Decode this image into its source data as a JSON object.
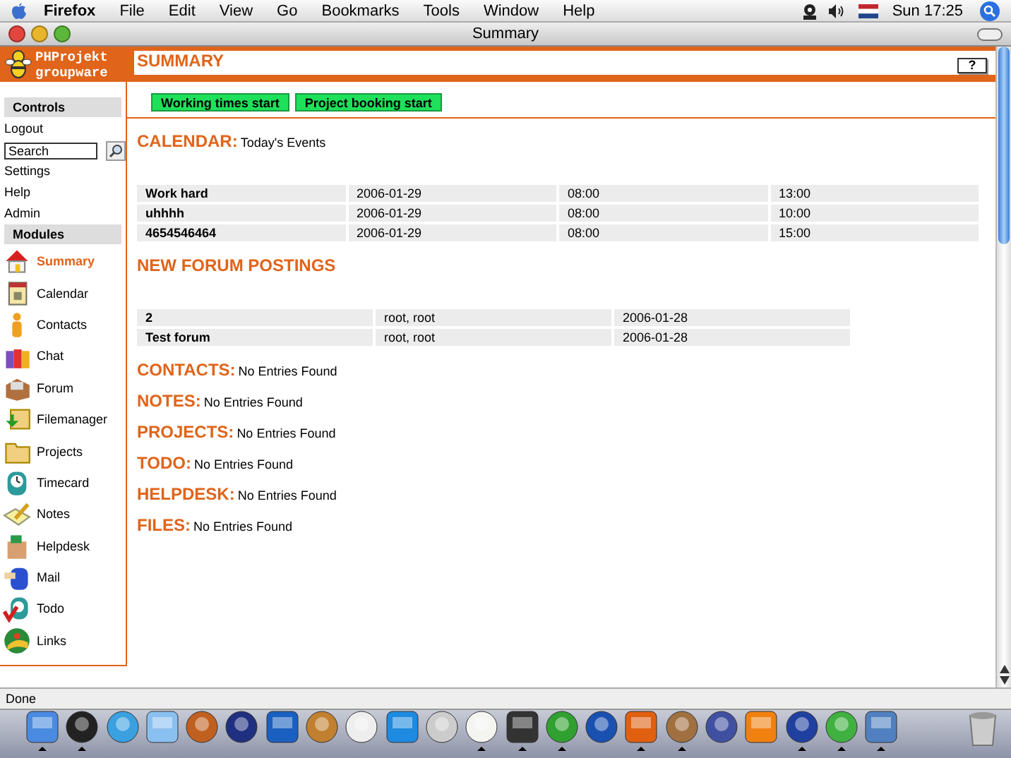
{
  "menubar": {
    "app": "Firefox",
    "items": [
      "File",
      "Edit",
      "View",
      "Go",
      "Bookmarks",
      "Tools",
      "Window",
      "Help"
    ],
    "clock": "Sun 17:25"
  },
  "window": {
    "title": "Summary"
  },
  "logo": {
    "line1": "PHProjekt",
    "line2": "groupware"
  },
  "page_title": "SUMMARY",
  "help_button": "?",
  "action_buttons": [
    "Working times start",
    "Project booking start"
  ],
  "sidebar": {
    "controls_heading": "Controls",
    "controls": [
      {
        "kind": "link",
        "label": "Logout"
      },
      {
        "kind": "search",
        "placeholder": "Search"
      },
      {
        "kind": "link",
        "label": "Settings"
      },
      {
        "kind": "link",
        "label": "Help"
      },
      {
        "kind": "link",
        "label": "Admin"
      }
    ],
    "modules_heading": "Modules",
    "modules": [
      {
        "label": "Summary",
        "selected": true
      },
      {
        "label": "Calendar",
        "selected": false
      },
      {
        "label": "Contacts",
        "selected": false
      },
      {
        "label": "Chat",
        "selected": false
      },
      {
        "label": "Forum",
        "selected": false
      },
      {
        "label": "Filemanager",
        "selected": false
      },
      {
        "label": "Projects",
        "selected": false
      },
      {
        "label": "Timecard",
        "selected": false
      },
      {
        "label": "Notes",
        "selected": false
      },
      {
        "label": "Helpdesk",
        "selected": false
      },
      {
        "label": "Mail",
        "selected": false
      },
      {
        "label": "Todo",
        "selected": false
      },
      {
        "label": "Links",
        "selected": false
      }
    ]
  },
  "sections": [
    {
      "kind": "table",
      "title": "CALENDAR:",
      "subtitle": "Today's Events",
      "wide": true,
      "rows": [
        [
          "Work hard",
          "2006-01-29",
          "08:00",
          "13:00"
        ],
        [
          "uhhhh",
          "2006-01-29",
          "08:00",
          "10:00"
        ],
        [
          "4654546464",
          "2006-01-29",
          "08:00",
          "15:00"
        ]
      ]
    },
    {
      "kind": "table",
      "title": "NEW FORUM POSTINGS",
      "wide": false,
      "rows": [
        [
          "2",
          "root, root",
          "2006-01-28"
        ],
        [
          "Test forum",
          "root, root",
          "2006-01-28"
        ]
      ]
    },
    {
      "kind": "empty",
      "title": "CONTACTS:",
      "message": "No Entries Found"
    },
    {
      "kind": "empty",
      "title": "NOTES:",
      "message": "No Entries Found"
    },
    {
      "kind": "empty",
      "title": "PROJECTS:",
      "message": "No Entries Found"
    },
    {
      "kind": "empty",
      "title": "TODO:",
      "message": "No Entries Found"
    },
    {
      "kind": "empty",
      "title": "HELPDESK:",
      "message": "No Entries Found"
    },
    {
      "kind": "empty",
      "title": "FILES:",
      "message": "No Entries Found"
    }
  ],
  "status_bar": "Done",
  "dock": {
    "items": [
      {
        "running": true
      },
      {
        "running": true
      },
      {
        "running": false
      },
      {
        "running": false
      },
      {
        "running": false
      },
      {
        "running": false
      },
      {
        "running": false
      },
      {
        "running": false
      },
      {
        "running": false
      },
      {
        "running": false
      },
      {
        "running": false
      },
      {
        "running": true
      },
      {
        "running": true
      },
      {
        "running": true
      },
      {
        "running": false
      },
      {
        "running": true
      },
      {
        "running": true
      },
      {
        "running": false
      },
      {
        "running": false
      },
      {
        "running": true
      },
      {
        "running": true
      },
      {
        "running": true
      }
    ]
  }
}
